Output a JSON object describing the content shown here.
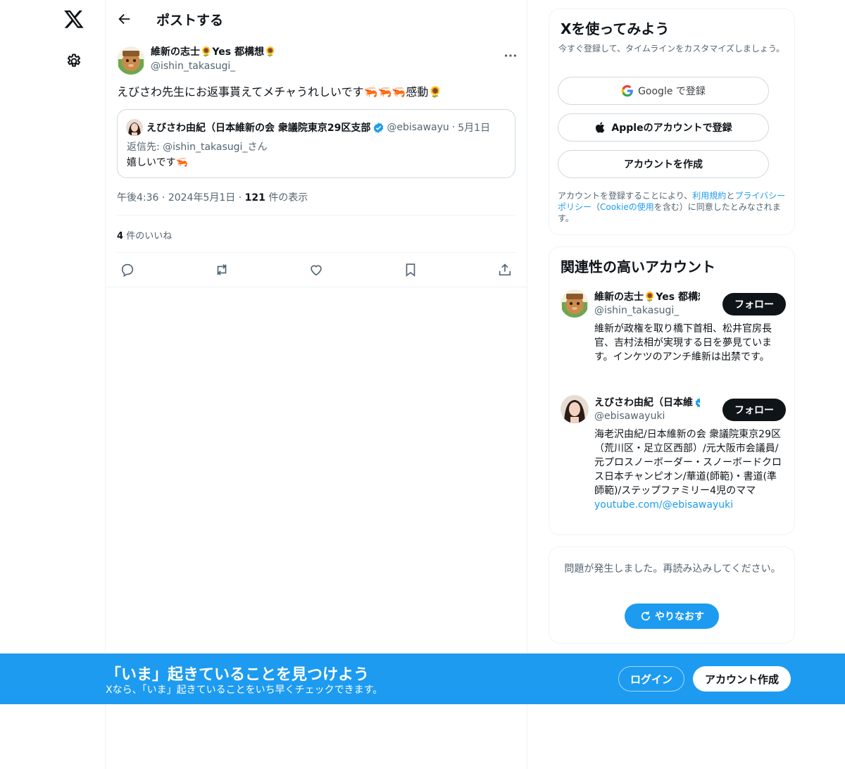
{
  "nav": {
    "logo_icon": "x-logo-icon",
    "settings_icon": "gear-icon"
  },
  "header": {
    "title": "ポストする"
  },
  "post": {
    "author_name": "維新の志士🌻Yes 都構想🌻",
    "author_handle": "@ishin_takasugi_",
    "text": "えびさわ先生にお返事貰えてメチャうれしいです🦐🦐🦐感動🌻",
    "quote": {
      "name": "えびさわ由紀（日本維新の会 衆議院東京29区支部",
      "handle": "@ebisawayu",
      "dot": "·",
      "date": "5月1日",
      "reply_to": "返信先: @ishin_takasugi_さん",
      "text": "嬉しいです🦐"
    },
    "time": "午後4:36",
    "date": "2024年5月1日",
    "views_count": "121",
    "views_label": "件の表示",
    "sep": "·",
    "likes_count": "4",
    "likes_label": "件のいいね"
  },
  "signup": {
    "title": "Xを使ってみよう",
    "subtitle": "今すぐ登録して、タイムラインをカスタマイズしましょう。",
    "google": "Google で登録",
    "apple": "Appleのアカウントで登録",
    "create": "アカウントを作成",
    "terms_1": "アカウントを登録することにより、",
    "terms_link_1": "利用規約",
    "terms_2": "と",
    "terms_link_2": "プライバシーポリシー",
    "terms_3": "（",
    "terms_link_3": "Cookieの使用",
    "terms_4": "を含む）に同意したとみなされます。"
  },
  "relevant": {
    "title": "関連性の高いアカウント",
    "accounts": [
      {
        "name": "維新の志士🌻Yes 都構想",
        "handle": "@ishin_takasugi_",
        "bio": "維新が政権を取り橋下首相、松井官房長官、吉村法相が実現する日を夢見ています。インケツのアンチ維新は出禁です。",
        "follow": "フォロー"
      },
      {
        "name": "えびさわ由紀（日本維",
        "handle": "@ebisawayuki",
        "bio": "海老沢由紀/日本維新の会 衆議院東京29区（荒川区・足立区西部）/元大阪市会議員/元プロスノーボーダー・スノーボードクロス日本チャンピオン/華道(師範)・書道(準師範)/ステップファミリー4児のママ",
        "link": "youtube.com/@ebisawayuki",
        "follow": "フォロー"
      }
    ]
  },
  "error": {
    "message": "問題が発生しました。再読み込みしてください。",
    "retry": "やりなおす"
  },
  "banner": {
    "title": "「いま」起きていることを見つけよう",
    "subtitle": "Xなら、「いま」起きていることをいち早くチェックできます。",
    "login": "ログイン",
    "signup": "アカウント作成"
  },
  "colors": {
    "accent": "#1d9bf0",
    "text": "#0f1419",
    "muted": "#536471",
    "border": "#cfd9de"
  }
}
